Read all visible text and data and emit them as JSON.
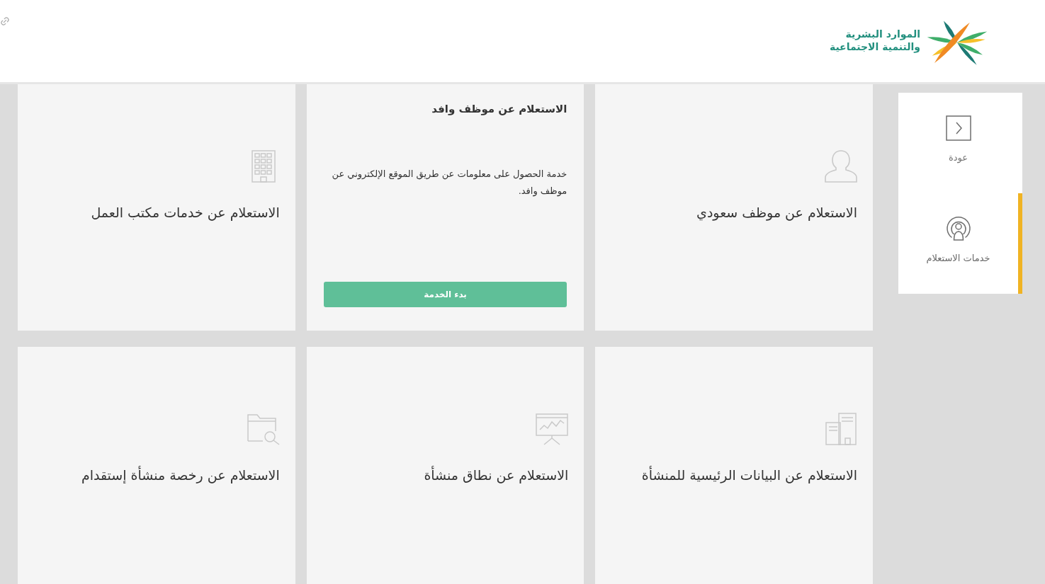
{
  "logo": {
    "lines": [
      "الموارد البشرية",
      "والتنمية الاجتماعية"
    ]
  },
  "sidebar": {
    "items": [
      {
        "label": "عودة",
        "selected": false
      },
      {
        "label": "خدمات الاستعلام",
        "selected": true
      }
    ]
  },
  "cards": [
    {
      "title": "الاستعلام عن موظف سعودي",
      "expanded": false
    },
    {
      "title": "الاستعلام عن موظف وافد",
      "expanded": true,
      "description": "خدمة الحصول على معلومات عن طريق الموقع الإلكتروني عن موظف وافد.",
      "button": "بدء الخدمة"
    },
    {
      "title": "الاستعلام عن خدمات مكتب العمل",
      "expanded": false
    },
    {
      "title": "الاستعلام عن البيانات الرئيسية للمنشأة",
      "expanded": false
    },
    {
      "title": "الاستعلام عن نطاق منشأة",
      "expanded": false
    },
    {
      "title": "الاستعلام عن رخصة منشأة إستقدام",
      "expanded": false
    }
  ]
}
